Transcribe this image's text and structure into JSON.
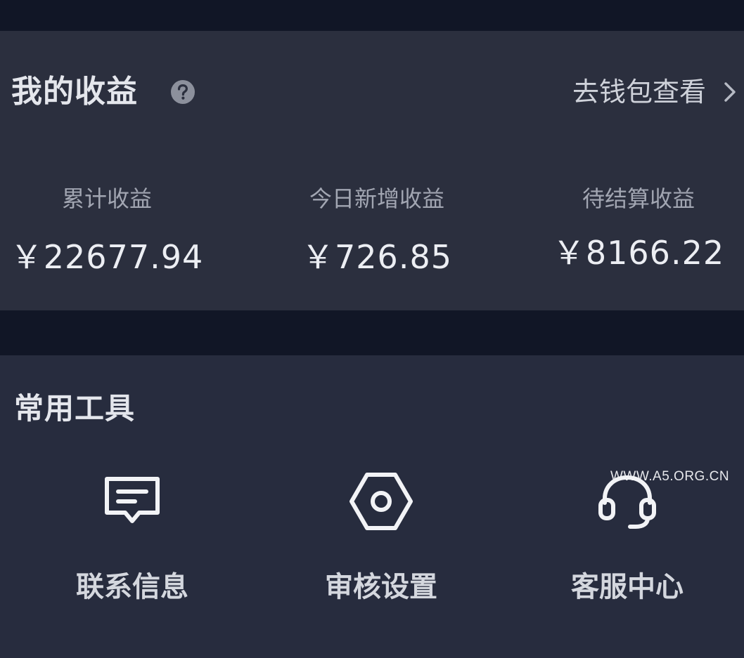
{
  "earnings": {
    "title": "我的收益",
    "help_icon": "question-circle-icon",
    "wallet_link": "去钱包查看",
    "stats": [
      {
        "label": "累计收益",
        "value": "￥22677.94"
      },
      {
        "label": "今日新增收益",
        "value": "￥726.85"
      },
      {
        "label": "待结算收益",
        "value": "￥8166.22"
      }
    ]
  },
  "tools": {
    "title": "常用工具",
    "items": [
      {
        "label": "联系信息",
        "icon": "message-card-icon"
      },
      {
        "label": "审核设置",
        "icon": "hexagon-settings-icon"
      },
      {
        "label": "客服中心",
        "icon": "headset-icon"
      }
    ]
  },
  "watermark": "WWW.A5.ORG.CN",
  "colors": {
    "page_bg": "#111626",
    "earnings_card_bg": "#2b2f3e",
    "tools_card_bg": "#272c3e",
    "icon_stroke": "#f2f3f6"
  }
}
